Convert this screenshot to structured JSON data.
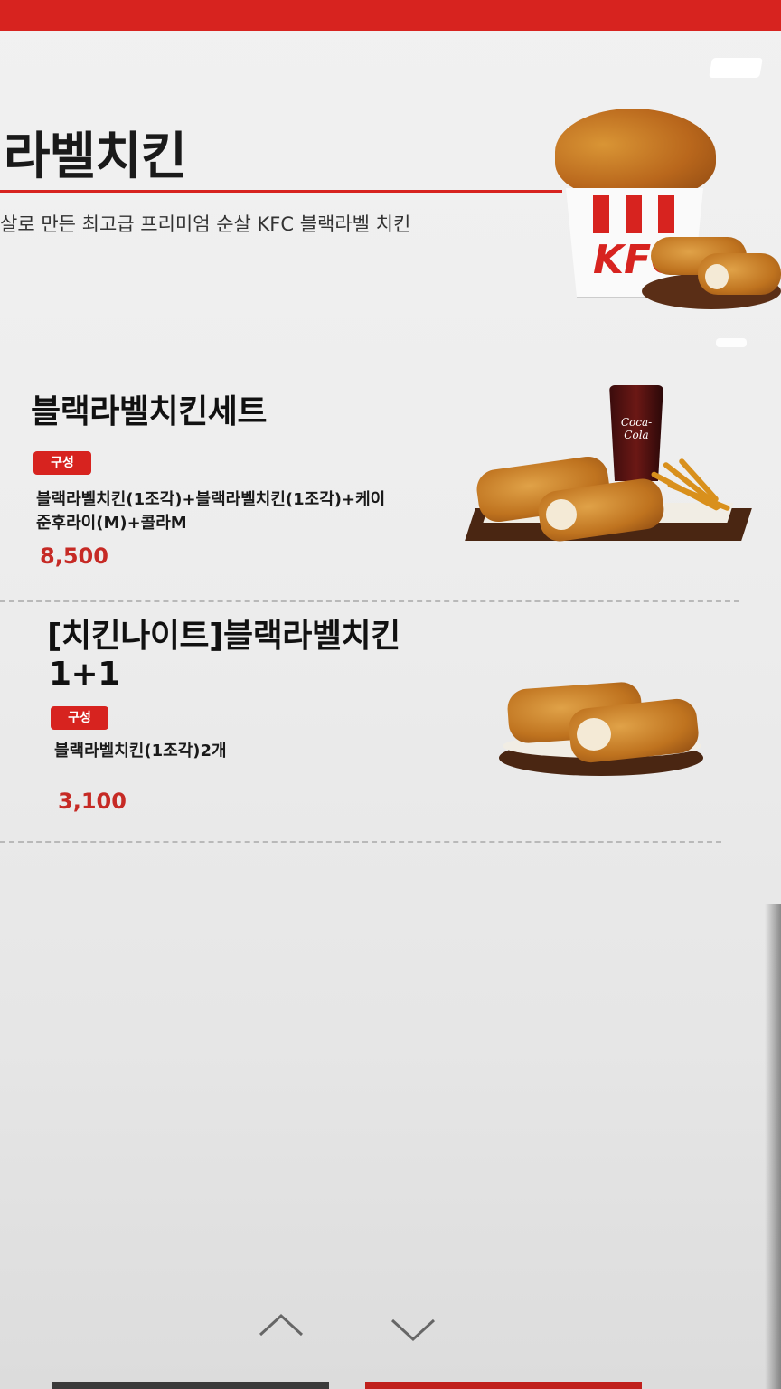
{
  "header": {
    "category_title": "라벨치킨",
    "category_description": "살로 만든 최고급 프리미엄 순살 KFC 블랙라벨 치킨",
    "bucket_logo": "KFC"
  },
  "menu_items": [
    {
      "name": "블랙라벨치킨세트",
      "badge": "구성",
      "description_line1": "블랙라벨치킨(1조각)+블랙라벨치킨(1조각)+케이",
      "description_line2": "준후라이(M)+콜라M",
      "price": "8,500"
    },
    {
      "name_line1": "[치킨나이트]블랙라벨치킨",
      "name_line2": "1+1",
      "badge": "구성",
      "description": "블랙라벨치킨(1조각)2개",
      "price": "3,100"
    }
  ],
  "images": {
    "cola_label": "Coca-Cola"
  },
  "colors": {
    "brand_red": "#d7231f",
    "price_red": "#c62a25"
  },
  "icons": {
    "scroll_up": "chevron-up-icon",
    "scroll_down": "chevron-down-icon"
  }
}
